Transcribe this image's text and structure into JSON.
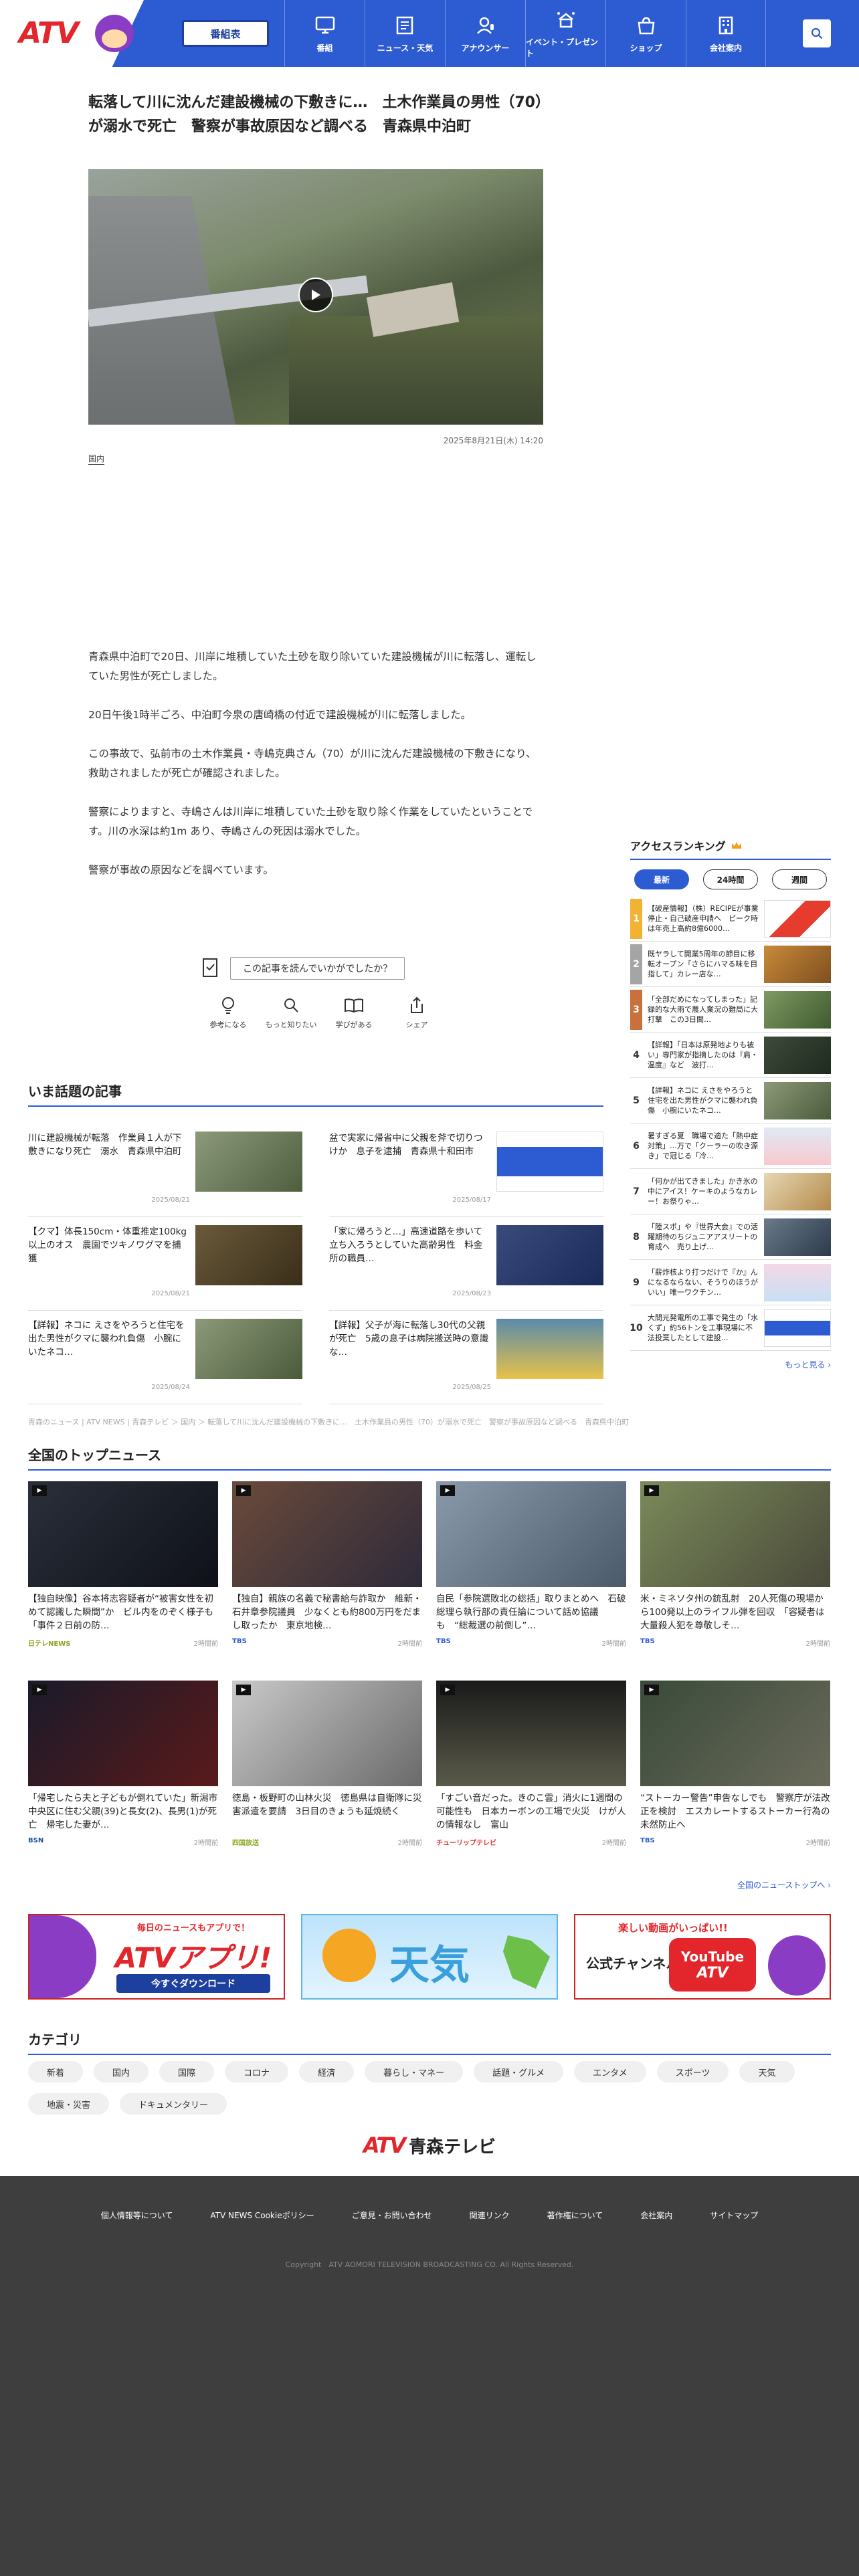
{
  "header": {
    "logo": "ATV",
    "schedule": "番組表",
    "nav": [
      {
        "label": "番組",
        "icon": "tv-icon"
      },
      {
        "label": "ニュース・天気",
        "icon": "newspaper-icon"
      },
      {
        "label": "アナウンサー",
        "icon": "announcer-icon"
      },
      {
        "label": "イベント・プレゼント",
        "icon": "event-icon"
      },
      {
        "label": "ショップ",
        "icon": "shop-icon"
      },
      {
        "label": "会社案内",
        "icon": "building-icon"
      }
    ]
  },
  "article": {
    "headline": "転落して川に沈んだ建設機械の下敷きに…　土木作業員の男性（70）が溺水で死亡　警察が事故原因など調べる　青森県中泊町",
    "date": "2025年8月21日(木) 14:20",
    "tag": "国内",
    "paragraphs": [
      "青森県中泊町で20日、川岸に堆積していた土砂を取り除いていた建設機械が川に転落し、運転していた男性が死亡しました。",
      "20日午後1時半ごろ、中泊町今泉の唐崎橋の付近で建設機械が川に転落しました。",
      "この事故で、弘前市の土木作業員・寺嶋克典さん（70）が川に沈んだ建設機械の下敷きになり、救助されましたが死亡が確認されました。",
      "警察によりますと、寺嶋さんは川岸に堆積していた土砂を取り除く作業をしていたということです。川の水深は約1m あり、寺嶋さんの死因は溺水でした。",
      "警察が事故の原因などを調べています。"
    ],
    "feedback": "この記事を読んでいかがでしたか？",
    "reactions": [
      "参考になる",
      "もっと知りたい",
      "学びがある",
      "シェア"
    ]
  },
  "ranking": {
    "title": "アクセスランキング",
    "tabs": [
      "最新",
      "24時間",
      "週間"
    ],
    "items": [
      {
        "num": "1",
        "text": "【破産情報】（株）RECIPEが事業停止・自己破産申請へ　ピーク時は年売上高約8億6000…"
      },
      {
        "num": "2",
        "text": "既ヤラして開業5周年の節目に移転オープン「さらにハマる味を目指して」カレー店な…"
      },
      {
        "num": "3",
        "text": "「全部だめになってしまった」記録的な大雨で農人業況の難局に大打撃　この3日間…"
      },
      {
        "num": "4",
        "text": "【詳報】「日本は原発地よりも被い」専門家が指摘したのは『肩・温度』など　波打…"
      },
      {
        "num": "5",
        "text": "【詳報】ネコに えさをやろうと住宅を出た男性がクマに襲われ負傷　小腕にいたネコ…"
      },
      {
        "num": "6",
        "text": "暑すぎる夏　職場で適た「熱中症対策」…万で「クーラーの吹き源き」で冠じる「冷…"
      },
      {
        "num": "7",
        "text": "「何かが出てきました」かき氷の中にアイス！ケーキのようなカレー！お祭りゃ…"
      },
      {
        "num": "8",
        "text": "「陸スポ」や『世界大会』での活躍期待のちジュニアアスリートの育成へ　売り上げ…"
      },
      {
        "num": "9",
        "text": "「薪炸核より打つだけで『か』んになるならない、そうりのほうがいい」唯一ワクチン…"
      },
      {
        "num": "10",
        "text": "大間光発電所の工事で発生の「水くず」約56トンを工事現場に不法投棄したとして建設…"
      }
    ],
    "more": "もっと見る"
  },
  "trending": {
    "title": "いま話題の記事",
    "items": [
      {
        "text": "川に建設機械が転落　作業員１人が下敷きになり死亡　溺水　青森県中泊町",
        "date": "2025/08/21"
      },
      {
        "text": "盆で実家に帰省中に父親を斧で切りつけか　息子を逮捕　青森県十和田市",
        "date": "2025/08/17"
      },
      {
        "text": "【クマ】体長150cm・体重推定100kg以上のオス　農園でツキノワグマを捕獲",
        "date": "2025/08/21"
      },
      {
        "text": "「家に帰ろうと…」高速道路を歩いて立ち入ろうとしていた高齢男性　料金所の職員…",
        "date": "2025/08/23"
      },
      {
        "text": "【詳報】ネコに えさをやろうと住宅を出た男性がクマに襲われ負傷　小腕にいたネコ…",
        "date": "2025/08/24"
      },
      {
        "text": "【詳報】父子が海に転落し30代の父親が死亡　5歳の息子は病院搬送時の意識な…",
        "date": "2025/08/25"
      }
    ]
  },
  "breadcrumb": "青森のニュース | ATV NEWS | 青森テレビ ＞ 国内 ＞ 転落して川に沈んだ建設機械の下敷きに…　土木作業員の男性（70）が溺水で死亡　警察が事故原因など調べる　青森県中泊町",
  "national": {
    "title": "全国のトップニュース",
    "items": [
      {
        "text": "【独自映像】谷本将志容疑者が“被害女性を初めて認識した瞬間”か　ビル内をのぞく様子も　「事件２日前の防…",
        "src": "日テレNEWS",
        "time": "2時間前"
      },
      {
        "text": "【独自】親族の名義で秘書給与詐取か　維新・石井章参院議員　少なくとも約800万円をだまし取ったか　東京地検…",
        "src": "TBS",
        "time": "2時間前"
      },
      {
        "text": "自民「参院選敗北の総括」取りまとめへ　石破総理ら執行部の責任論について話め協議も　“総裁選の前倒し”…",
        "src": "TBS",
        "time": "2時間前"
      },
      {
        "text": "米・ミネソタ州の銃乱射　20人死傷の現場から100発以上のライフル弾を回収　「容疑者は大量殺人犯を尊敬しそ…",
        "src": "TBS",
        "time": "2時間前"
      },
      {
        "text": "「帰宅したら夫と子どもが倒れていた」新潟市中央区に住む父親(39)と長女(2)、長男(1)が死亡　帰宅した妻が…",
        "src": "BSN",
        "time": "2時間前"
      },
      {
        "text": "徳島・板野町の山林火災　徳島県は自衛隊に災害派遣を要請　3日目のきょうも延焼続く",
        "src": "四国放送",
        "time": "2時間前"
      },
      {
        "text": "「すごい音だった。きのこ雲」消火に1週間の可能性も　日本カーボンの工場で火災　けが人の情報なし　富山",
        "src": "チューリップテレビ",
        "time": "2時間前"
      },
      {
        "text": "“ストーカー警告”申告なしでも　警察庁が法改正を検討　エスカレートするストーカー行為の未然防止へ",
        "src": "TBS",
        "time": "2時間前"
      }
    ],
    "more": "全国のニューストップへ"
  },
  "banners": {
    "app_top": "毎日のニュースもアプリで！",
    "app_name": "ATVアプリ!",
    "app_cta": "今すぐダウンロード",
    "weather": "天気",
    "yt_top": "楽しい動画がいっぱい!!",
    "yt_label": "公式チャンネル",
    "yt_name": "YouTube",
    "yt_sub": "ATV"
  },
  "category": {
    "title": "カテゴリ",
    "items": [
      "新着",
      "国内",
      "国際",
      "コロナ",
      "経済",
      "暮らし・マネー",
      "話題・グルメ",
      "エンタメ",
      "スポーツ",
      "天気",
      "地震・災害",
      "ドキュメンタリー"
    ]
  },
  "footer": {
    "logo_a": "ATV",
    "logo_b": "青森テレビ",
    "links": [
      "個人情報等について",
      "ATV NEWS Cookieポリシー",
      "ご意見・お問い合わせ",
      "関連リンク",
      "著作権について",
      "会社案内",
      "サイトマップ"
    ],
    "copyright": "Copyright　ATV AOMORI TELEVISION BROADCASTING CO. All Rights Reserved."
  }
}
